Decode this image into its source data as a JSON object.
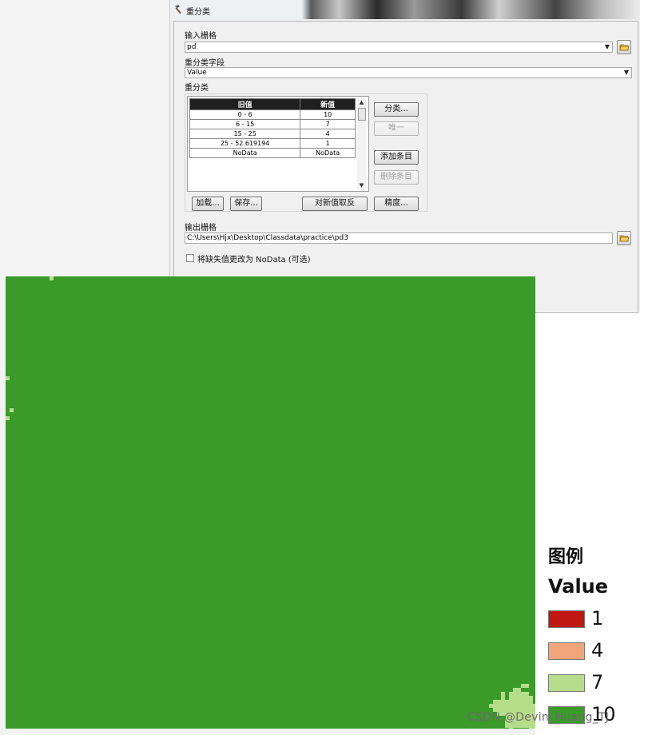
{
  "dialog": {
    "title": "重分类",
    "input_raster_label": "输入栅格",
    "input_raster_value": "pd",
    "reclass_field_label": "重分类字段",
    "reclass_field_value": "Value",
    "reclass_label": "重分类",
    "table": {
      "headers": [
        "旧值",
        "新值"
      ],
      "rows": [
        [
          "0 - 6",
          "10"
        ],
        [
          "6 - 15",
          "7"
        ],
        [
          "15 - 25",
          "4"
        ],
        [
          "25 - 52.619194",
          "1"
        ],
        [
          "NoData",
          "NoData"
        ]
      ]
    },
    "buttons": {
      "classify": "分类...",
      "unique": "唯一",
      "add_entry": "添加条目",
      "delete_entry": "删除条目",
      "load": "加载...",
      "save": "保存...",
      "reverse": "对新值取反",
      "precision": "精度..."
    },
    "output_raster_label": "输出栅格",
    "output_raster_value": "C:\\Users\\Hjx\\Desktop\\Classdata\\practice\\pd3",
    "nodata_checkbox_label": "将缺失值更改为 NoData (可选)",
    "nodata_checked": false
  },
  "legend": {
    "title": "图例",
    "field": "Value",
    "items": [
      {
        "label": "1",
        "color": "#c01712"
      },
      {
        "label": "4",
        "color": "#f2a57a"
      },
      {
        "label": "7",
        "color": "#b6dd8a"
      },
      {
        "label": "10",
        "color": "#3a9a2a"
      }
    ]
  },
  "watermark": "CSDN @Devin_Huang_TJ",
  "icons": {
    "title": "hammer-icon",
    "browse": "folder-open-icon",
    "dropdown": "chevron-down-icon"
  }
}
